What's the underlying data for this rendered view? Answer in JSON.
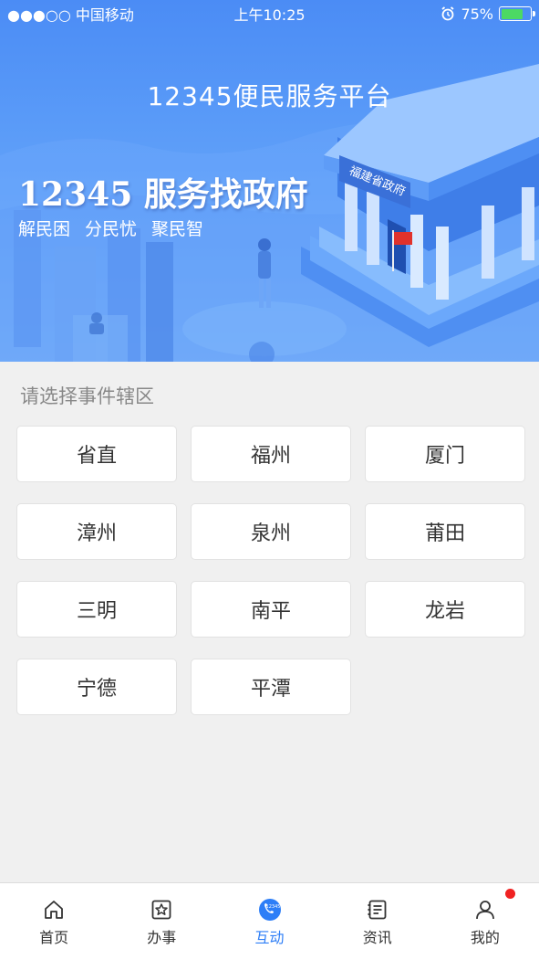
{
  "status_bar": {
    "carrier": "●●●○○ 中国移动",
    "time": "上午10:25",
    "battery": "75%",
    "battery_level": 0.75,
    "battery_color": "#4cd964"
  },
  "banner": {
    "title": "12345便民服务平台",
    "slogan": "12345 服务找政府",
    "subslogans": [
      "解民困",
      "分民忧",
      "聚民智"
    ],
    "building_sign": "福建省政府",
    "gradient_top": "#4b8cf5",
    "gradient_bottom": "#7eb5fb"
  },
  "region_section": {
    "title": "请选择事件辖区",
    "regions": [
      "省直",
      "福州",
      "厦门",
      "漳州",
      "泉州",
      "莆田",
      "三明",
      "南平",
      "龙岩",
      "宁德",
      "平潭"
    ]
  },
  "tab_bar": {
    "active_color": "#2d7ef7",
    "tabs": [
      {
        "label": "首页",
        "icon": "home-icon"
      },
      {
        "label": "办事",
        "icon": "star-box-icon"
      },
      {
        "label": "互动",
        "icon": "phone-12345-icon",
        "active": true,
        "icon_text": "12345"
      },
      {
        "label": "资讯",
        "icon": "news-icon"
      },
      {
        "label": "我的",
        "icon": "user-icon",
        "badge": true
      }
    ]
  }
}
